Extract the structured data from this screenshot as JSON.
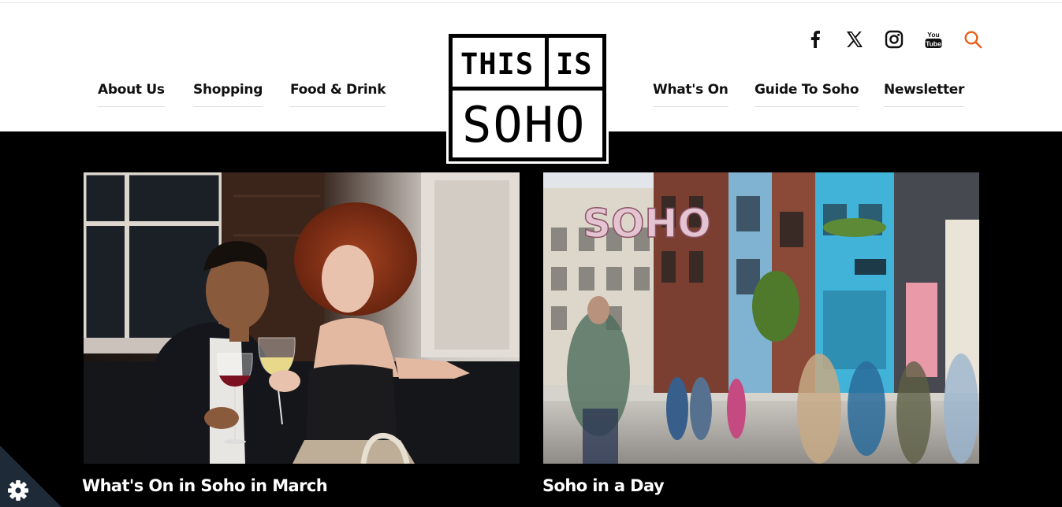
{
  "nav": {
    "left": [
      {
        "label": "About Us"
      },
      {
        "label": "Shopping"
      },
      {
        "label": "Food & Drink"
      }
    ],
    "right": [
      {
        "label": "What's On"
      },
      {
        "label": "Guide To Soho"
      },
      {
        "label": "Newsletter"
      }
    ]
  },
  "logo": {
    "line1_word1": "THIS",
    "line1_word2": "IS",
    "line2": "SOHO"
  },
  "social": {
    "icons": [
      "facebook-icon",
      "x-icon",
      "instagram-icon",
      "youtube-icon",
      "search-icon"
    ],
    "youtube_text_top": "You",
    "youtube_text_bottom": "Tube",
    "search_color": "#e8601c"
  },
  "cards": [
    {
      "title": "What's On in Soho in March",
      "image": "couple-with-wine-photo"
    },
    {
      "title": "Soho in a Day",
      "image": "soho-street-photo",
      "sign_text": "SOHO"
    }
  ],
  "cookie": {
    "icon": "gear-icon"
  },
  "colors": {
    "background": "#000000",
    "header": "#ffffff",
    "accent": "#e8601c"
  }
}
